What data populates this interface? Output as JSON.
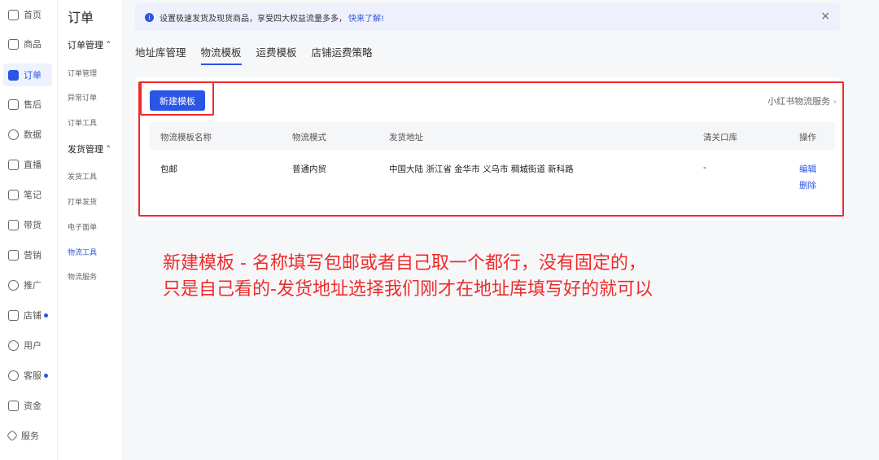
{
  "nav": {
    "items": [
      {
        "label": "首页",
        "icon": "home-icon"
      },
      {
        "label": "商品",
        "icon": "goods-icon"
      },
      {
        "label": "订单",
        "icon": "order-icon"
      },
      {
        "label": "售后",
        "icon": "after-sale-icon"
      },
      {
        "label": "数据",
        "icon": "data-icon"
      },
      {
        "label": "直播",
        "icon": "live-icon"
      },
      {
        "label": "笔记",
        "icon": "notes-icon"
      },
      {
        "label": "带货",
        "icon": "bag-icon"
      },
      {
        "label": "营销",
        "icon": "marketing-icon"
      },
      {
        "label": "推广",
        "icon": "promote-icon"
      },
      {
        "label": "店铺",
        "icon": "store-icon"
      },
      {
        "label": "用户",
        "icon": "users-icon"
      },
      {
        "label": "客服",
        "icon": "service-chat-icon"
      },
      {
        "label": "资金",
        "icon": "funds-icon"
      },
      {
        "label": "服务",
        "icon": "service-icon"
      }
    ],
    "active": "订单"
  },
  "subnav": {
    "title": "订单",
    "group1": "订单管理 ˄",
    "group1_items": [
      "订单管理",
      "异常订单",
      "订单工具"
    ],
    "group2": "发货管理 ˄",
    "group2_items": [
      "发货工具",
      "打单发货",
      "电子面单",
      "物流工具",
      "物流服务"
    ]
  },
  "banner": {
    "text": "设置极速发货及现货商品，享受四大权益流量多多，",
    "link": "快来了解!",
    "close": "×"
  },
  "tabs": [
    "地址库管理",
    "物流模板",
    "运费模板",
    "店铺运费策略"
  ],
  "toolbar": {
    "new_button": "新建模板",
    "service_link": "小红书物流服务"
  },
  "table": {
    "headers": [
      "物流模板名称",
      "物流模式",
      "发货地址",
      "清关口库",
      "操作"
    ],
    "row": {
      "name": "包邮",
      "mode": "普通内贸",
      "address": "中国大陆 浙江省 金华市 义乌市 稠城街道 新科路",
      "customs": "-",
      "edit": "编辑",
      "delete": "删除"
    }
  },
  "annotation": {
    "line1": "新建模板 - 名称填写包邮或者自己取一个都行，没有固定的，",
    "line2": "只是自己看的-发货地址选择我们刚才在地址库填写好的就可以"
  },
  "colors": {
    "accent": "#2a55e5",
    "annotation_red": "#ee2b2b"
  }
}
